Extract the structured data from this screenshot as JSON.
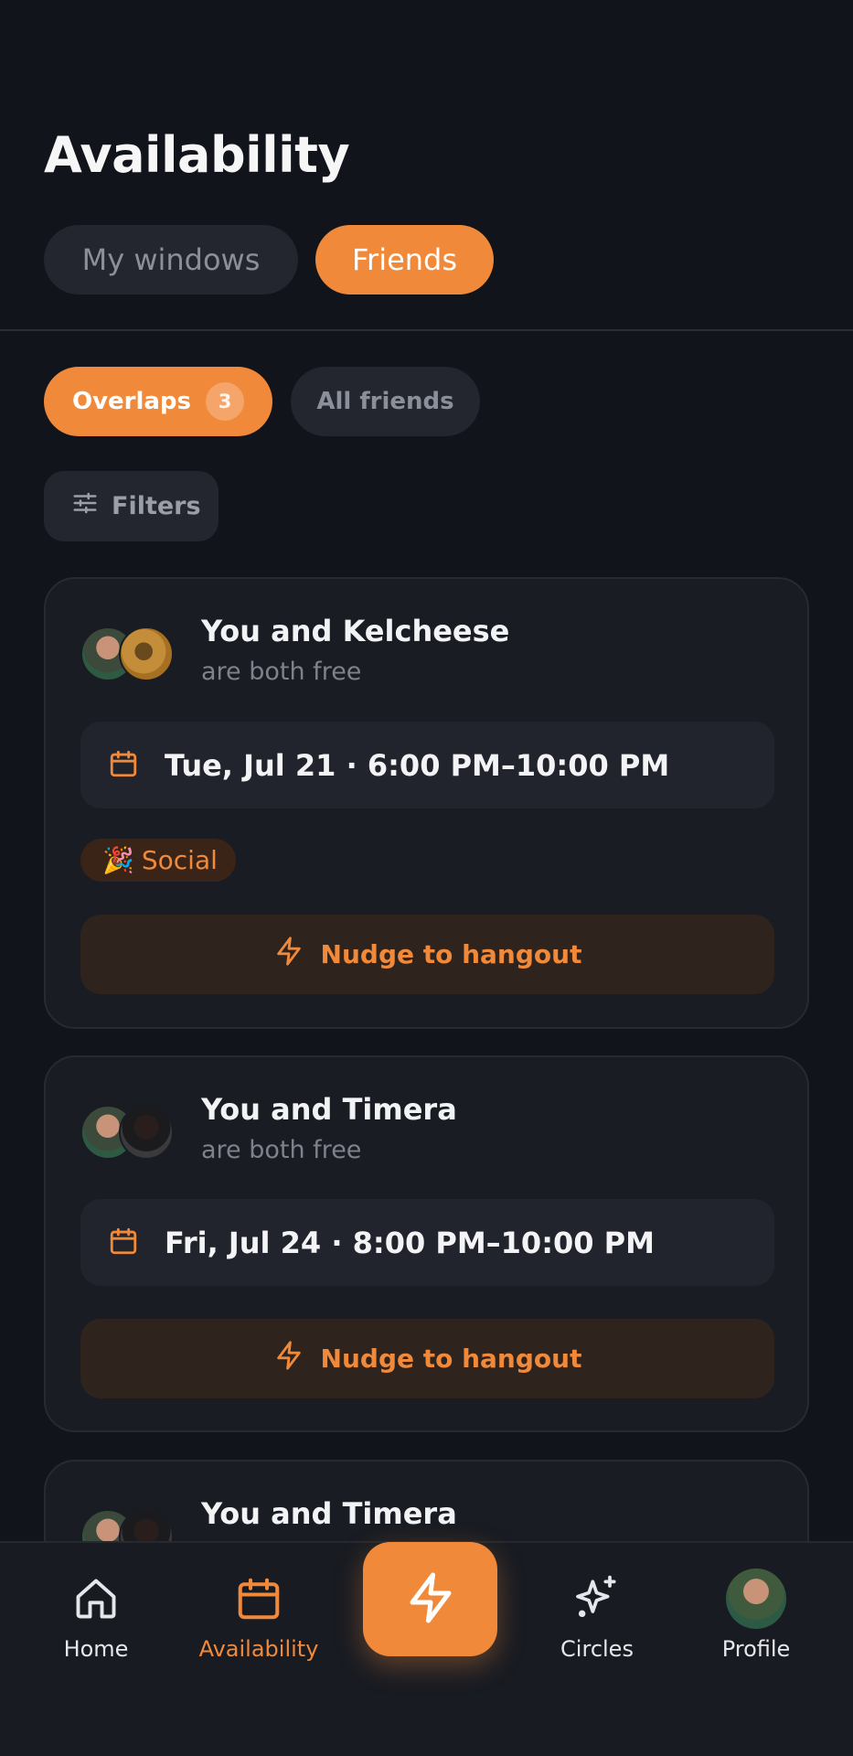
{
  "header": {
    "title": "Availability",
    "tabs": [
      {
        "label": "My windows",
        "active": false
      },
      {
        "label": "Friends",
        "active": true
      }
    ]
  },
  "filters": {
    "chips": [
      {
        "label": "Overlaps",
        "count": "3",
        "active": true
      },
      {
        "label": "All friends",
        "active": false
      }
    ],
    "filters_label": "Filters"
  },
  "overlaps": [
    {
      "title": "You and Kelcheese",
      "subtitle": "are both free",
      "time": "Tue, Jul 21 · 6:00 PM–10:00 PM",
      "tag": {
        "emoji": "🎉",
        "label": "Social"
      },
      "nudge_label": "Nudge to hangout"
    },
    {
      "title": "You and Timera",
      "subtitle": "are both free",
      "time": "Fri, Jul 24 · 8:00 PM–10:00 PM",
      "nudge_label": "Nudge to hangout"
    },
    {
      "title": "You and Timera"
    }
  ],
  "bottom_nav": {
    "items": [
      {
        "label": "Home",
        "icon": "home-icon"
      },
      {
        "label": "Availability",
        "icon": "calendar-icon",
        "active": true
      },
      {
        "label": "Circles",
        "icon": "sparkles-icon"
      },
      {
        "label": "Profile",
        "icon": "avatar"
      }
    ],
    "fab_icon": "lightning-icon"
  },
  "colors": {
    "background": "#11141b",
    "accent": "#f08a3a",
    "card": "#191c23"
  }
}
